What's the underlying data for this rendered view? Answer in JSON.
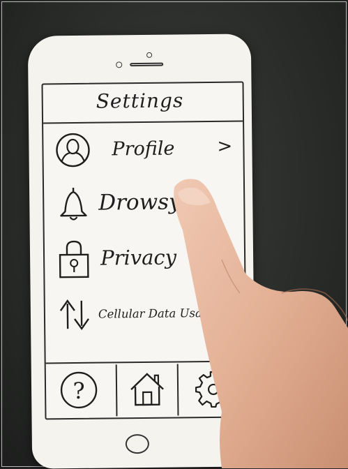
{
  "header": {
    "title": "Settings"
  },
  "menu": {
    "items": [
      {
        "label": "Profile",
        "icon": "person-icon",
        "chevron": ">"
      },
      {
        "label": "Drowsy A",
        "icon": "bell-icon"
      },
      {
        "label": "Privacy",
        "icon": "lock-icon"
      },
      {
        "label": "Cellular Data Usage",
        "icon": "up-down-arrows-icon",
        "chevron": ">"
      }
    ]
  },
  "tabbar": {
    "tabs": [
      {
        "icon": "help-icon",
        "symbol": "?"
      },
      {
        "icon": "home-icon"
      },
      {
        "icon": "gear-icon"
      }
    ]
  },
  "colors": {
    "paper": "#f4f3ee",
    "ink": "#1e1e1e",
    "background": "#262826",
    "skin": "#e6b9a1"
  }
}
